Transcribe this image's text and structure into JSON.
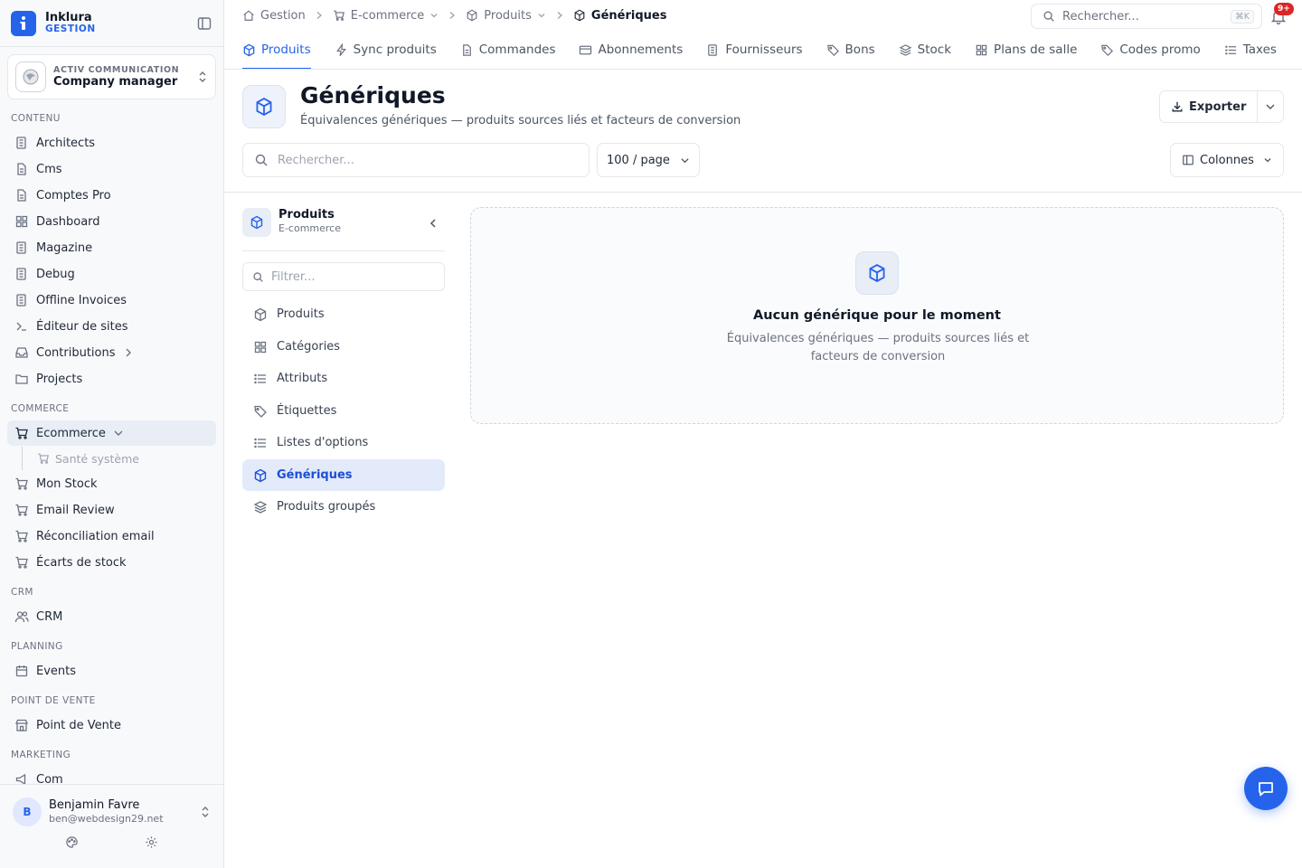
{
  "brand": {
    "name": "Inklura",
    "sub": "GESTION",
    "accent": "#2563eb"
  },
  "company": {
    "kicker": "ACTIV COMMUNICATION",
    "role": "Company manager"
  },
  "sidebar": {
    "sections": [
      {
        "label": "CONTENU",
        "items": [
          {
            "label": "Architects",
            "icon": "building-icon"
          },
          {
            "label": "Cms",
            "icon": "document-icon"
          },
          {
            "label": "Comptes Pro",
            "icon": "document-icon"
          },
          {
            "label": "Dashboard",
            "icon": "grid-icon"
          },
          {
            "label": "Magazine",
            "icon": "building-icon"
          },
          {
            "label": "Debug",
            "icon": "building-icon"
          },
          {
            "label": "Offline Invoices",
            "icon": "building-icon"
          },
          {
            "label": "Éditeur de sites",
            "icon": "terminal-icon"
          },
          {
            "label": "Contributions",
            "icon": "inbox-icon"
          },
          {
            "label": "Projects",
            "icon": "folder-icon"
          }
        ]
      },
      {
        "label": "COMMERCE",
        "items": [
          {
            "label": "Ecommerce",
            "icon": "cart-icon"
          },
          {
            "label": "Santé système",
            "icon": "cart-icon"
          },
          {
            "label": "Mon Stock",
            "icon": "cart-icon"
          },
          {
            "label": "Email Review",
            "icon": "cart-icon"
          },
          {
            "label": "Réconciliation email",
            "icon": "cart-icon"
          },
          {
            "label": "Écarts de stock",
            "icon": "cart-icon"
          }
        ]
      },
      {
        "label": "CRM",
        "items": [
          {
            "label": "CRM",
            "icon": "users-icon"
          }
        ]
      },
      {
        "label": "PLANNING",
        "items": [
          {
            "label": "Events",
            "icon": "calendar-icon"
          }
        ]
      },
      {
        "label": "POINT DE VENTE",
        "items": [
          {
            "label": "Point de Vente",
            "icon": "store-icon"
          }
        ]
      },
      {
        "label": "MARKETING",
        "items": [
          {
            "label": "Com",
            "icon": "megaphone-icon"
          }
        ]
      }
    ]
  },
  "user": {
    "initial": "B",
    "name": "Benjamin Favre",
    "email": "ben@webdesign29.net"
  },
  "breadcrumb": [
    "Gestion",
    "E-commerce",
    "Produits",
    "Génériques"
  ],
  "search": {
    "placeholder": "Rechercher...",
    "shortcut": "⌘K"
  },
  "notifications": {
    "badge": "9+"
  },
  "tabs": [
    "Produits",
    "Sync produits",
    "Commandes",
    "Abonnements",
    "Fournisseurs",
    "Bons",
    "Stock",
    "Plans de salle",
    "Codes promo",
    "Taxes"
  ],
  "page": {
    "title": "Génériques",
    "subtitle": "Équivalences génériques — produits sources liés et facteurs de conversion",
    "export_label": "Exporter",
    "search_placeholder": "Rechercher...",
    "per_page": "100 / page",
    "columns_label": "Colonnes"
  },
  "subnav": {
    "title": "Produits",
    "subtitle": "E-commerce",
    "filter_placeholder": "Filtrer...",
    "items": [
      "Produits",
      "Catégories",
      "Attributs",
      "Étiquettes",
      "Listes d'options",
      "Génériques",
      "Produits groupés"
    ]
  },
  "empty": {
    "title": "Aucun générique pour le moment",
    "text": "Équivalences génériques — produits sources liés et facteurs de conversion"
  }
}
